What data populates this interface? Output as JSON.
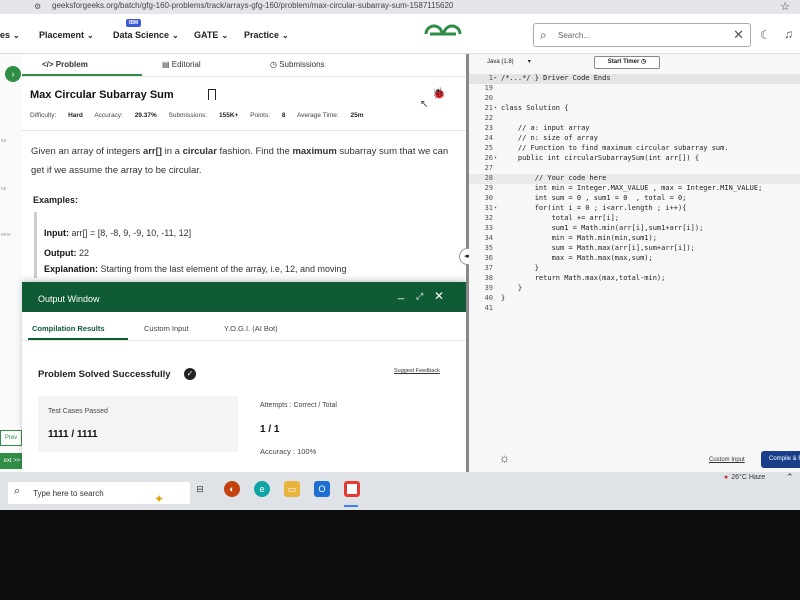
{
  "browser": {
    "url": "geeksforgeeks.org/batch/gfg-160-problems/track/arrays-gfg-160/problem/max-circular-subarray-sum-1587115620"
  },
  "nav": {
    "items": [
      {
        "label": "es"
      },
      {
        "label": "Placement"
      },
      {
        "label": "Data Science"
      },
      {
        "label": "GATE"
      },
      {
        "label": "Practice"
      }
    ],
    "badge": "IBM",
    "search_placeholder": "Search..."
  },
  "problem": {
    "tabs": {
      "problem": "Problem",
      "editorial": "Editorial",
      "submissions": "Submissions"
    },
    "title": "Max Circular Subarray Sum",
    "meta": {
      "difficulty_label": "Difficulty:",
      "difficulty": "Hard",
      "accuracy_label": "Accuracy:",
      "accuracy": "29.37%",
      "submissions_label": "Submissions:",
      "submissions": "155K+",
      "points_label": "Points:",
      "points": "8",
      "avg_time_label": "Average Time:",
      "avg_time": "25m"
    },
    "description_parts": {
      "p1": "Given an array of integers ",
      "arr": "arr[]",
      "p2": " in a ",
      "circular": "circular",
      "p3": " fashion. Find the ",
      "maximum": "maximum",
      "p4": " subarray sum that we can get if we assume the array to be circular."
    },
    "examples_label": "Examples:",
    "example": {
      "input_label": "Input:",
      "input_value": " arr[] = [8, -8, 9, -9, 10, -11, 12]",
      "output_label": "Output:",
      "output_value": " 22",
      "explanation_label": "Explanation:",
      "explanation_value": " Starting from the last element of the array, i.e, 12, and moving"
    }
  },
  "side": {
    "labels": [
      "es",
      "ns",
      "ems"
    ],
    "prev": "Prev",
    "next": "ext >>"
  },
  "output_window": {
    "title": "Output Window",
    "tabs": {
      "compilation": "Compilation Results",
      "custom_input": "Custom Input",
      "yogi": "Y.O.G.I. (AI Bot)"
    },
    "status": "Problem Solved Successfully",
    "suggest_feedback": "Suggest Feedback",
    "test_cases_label": "Test Cases Passed",
    "test_cases_value": "1111 / 1111",
    "attempts_label": "Attempts : Correct / Total",
    "attempts_value": "1 / 1",
    "accuracy_label": "Accuracy : 100%"
  },
  "editor": {
    "language": "Java (1.8)",
    "start_timer": "Start Timer",
    "custom_input": "Custom Input",
    "compile": "Compile & Run",
    "lines": [
      {
        "n": "1",
        "fold": "▸",
        "code": "/*...*/ } Driver Code Ends",
        "cls": "hl cm2"
      },
      {
        "n": "19",
        "fold": "",
        "code": "",
        "cls": ""
      },
      {
        "n": "20",
        "fold": "",
        "code": "",
        "cls": ""
      },
      {
        "n": "21",
        "fold": "▾",
        "code": "class Solution {",
        "cls": "kw"
      },
      {
        "n": "22",
        "fold": "",
        "code": "",
        "cls": ""
      },
      {
        "n": "23",
        "fold": "",
        "code": "    // a: input array",
        "cls": "cm"
      },
      {
        "n": "24",
        "fold": "",
        "code": "    // n: size of array",
        "cls": "cm"
      },
      {
        "n": "25",
        "fold": "",
        "code": "    // Function to find maximum circular subarray sum.",
        "cls": "cm"
      },
      {
        "n": "26",
        "fold": "▾",
        "code": "    public int circularSubarraySum(int arr[]) {",
        "cls": "kw"
      },
      {
        "n": "27",
        "fold": "",
        "code": "",
        "cls": ""
      },
      {
        "n": "28",
        "fold": "",
        "code": "        // Your code here",
        "cls": "active cm"
      },
      {
        "n": "29",
        "fold": "",
        "code": "        int min = Integer.MAX_VALUE , max = Integer.MIN_VALUE;",
        "cls": "kw"
      },
      {
        "n": "30",
        "fold": "",
        "code": "        int sum = 0 , sum1 = 0  , total = 0;",
        "cls": "kw"
      },
      {
        "n": "31",
        "fold": "▾",
        "code": "        for(int i = 0 ; i<arr.length ; i++){",
        "cls": "kw"
      },
      {
        "n": "32",
        "fold": "",
        "code": "            total += arr[i];",
        "cls": ""
      },
      {
        "n": "33",
        "fold": "",
        "code": "            sum1 = Math.min(arr[i],sum1+arr[i]);",
        "cls": ""
      },
      {
        "n": "34",
        "fold": "",
        "code": "            min = Math.min(min,sum1);",
        "cls": ""
      },
      {
        "n": "35",
        "fold": "",
        "code": "            sum = Math.max(arr[i],sum+arr[i]);",
        "cls": ""
      },
      {
        "n": "36",
        "fold": "",
        "code": "            max = Math.max(max,sum);",
        "cls": ""
      },
      {
        "n": "37",
        "fold": "",
        "code": "        }",
        "cls": ""
      },
      {
        "n": "38",
        "fold": "",
        "code": "        return Math.max(max,total-min);",
        "cls": "kw"
      },
      {
        "n": "39",
        "fold": "",
        "code": "    }",
        "cls": ""
      },
      {
        "n": "40",
        "fold": "",
        "code": "}",
        "cls": ""
      },
      {
        "n": "41",
        "fold": "",
        "code": "",
        "cls": ""
      }
    ]
  },
  "taskbar": {
    "search_placeholder": "Type here to search",
    "weather": "26°C  Haze"
  }
}
